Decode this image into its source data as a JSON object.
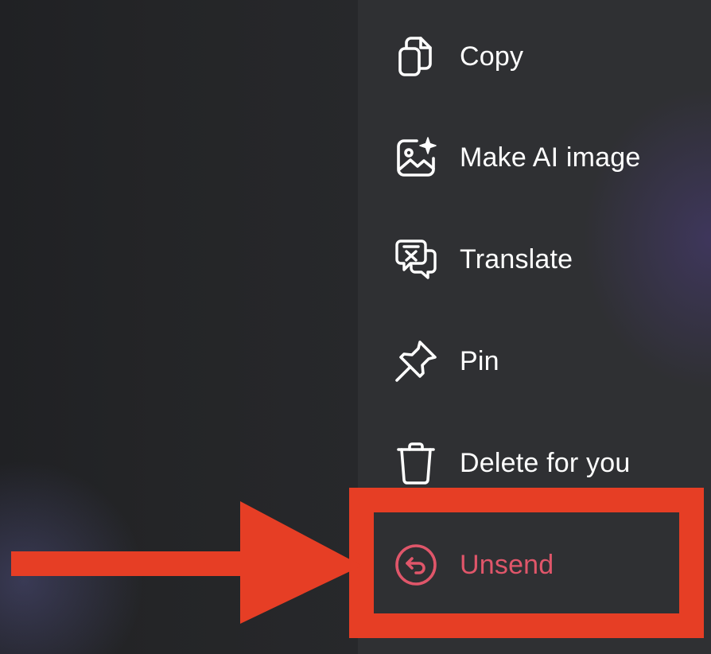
{
  "menu": {
    "items": [
      {
        "label": "Copy",
        "icon": "copy-icon"
      },
      {
        "label": "Make AI image",
        "icon": "ai-image-icon"
      },
      {
        "label": "Translate",
        "icon": "translate-icon"
      },
      {
        "label": "Pin",
        "icon": "pin-icon"
      },
      {
        "label": "Delete for you",
        "icon": "trash-icon"
      },
      {
        "label": "Unsend",
        "icon": "unsend-icon"
      }
    ]
  },
  "colors": {
    "menu_background": "#2f3033",
    "text": "#ffffff",
    "destructive": "#e0566a",
    "annotation": "#e63e25"
  }
}
